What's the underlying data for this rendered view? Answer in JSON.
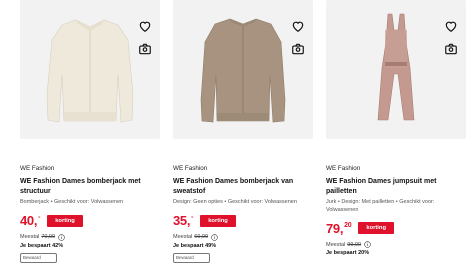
{
  "products": [
    {
      "brand": "WE Fashion",
      "title": "WE Fashion Dames bomberjack met structuur",
      "description": "Bomberjack • Geschikt voor: Volwassenen",
      "price_main": "40,",
      "price_cents": "-",
      "badge": "korting",
      "was_label": "Meestal",
      "was_price": "70,00",
      "save": "Je bespaart 42%",
      "stub_label": "Bewaard"
    },
    {
      "brand": "WE Fashion",
      "title": "WE Fashion Dames bomberjack van sweatstof",
      "description": "Design: Geen opties • Geschikt voor: Volwassenen",
      "price_main": "35,",
      "price_cents": "-",
      "badge": "korting",
      "was_label": "Meestal",
      "was_price": "69,00",
      "save": "Je bespaart 49%",
      "stub_label": "Bewaard"
    },
    {
      "brand": "WE Fashion",
      "title": "WE Fashion Dames jumpsuit met pailletten",
      "description": "Jurk • Design: Met pailletten • Geschikt voor: Volwassenen",
      "price_main": "79,",
      "price_cents": "20",
      "badge": "korting",
      "was_label": "Meestal",
      "was_price": "99,00",
      "save": "Je bespaart 20%"
    }
  ],
  "icons": {
    "wishlist": "heart-icon",
    "visual_search": "camera-search-icon",
    "info": "info-icon"
  },
  "colors": {
    "accent": "#e0112b",
    "image_bg": "#f2f2f2",
    "jacket1": "#efe9dc",
    "jacket2": "#a79380",
    "jumpsuit": "#c49a90"
  }
}
